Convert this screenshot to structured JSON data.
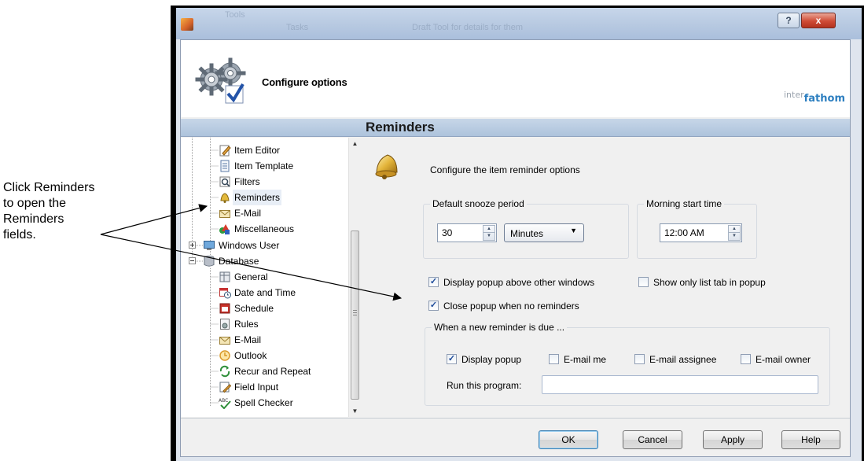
{
  "callout": {
    "lines": [
      "Click Reminders",
      "to open the",
      "Reminders",
      "fields."
    ]
  },
  "titlebar": {
    "help_label": "?",
    "close_label": "x",
    "ghost_text": [
      "Tools",
      "Tasks",
      "Draft Tool for details for them"
    ]
  },
  "header": {
    "title": "Configure options",
    "brand_prefix": "inter",
    "brand_name": "fathom"
  },
  "section_title": "Reminders",
  "tree": {
    "items": [
      {
        "label": "Item Editor",
        "icon": "pencil-icon"
      },
      {
        "label": "Item Template",
        "icon": "template-icon"
      },
      {
        "label": "Filters",
        "icon": "filter-icon"
      },
      {
        "label": "Reminders",
        "icon": "bell-icon",
        "selected": true
      },
      {
        "label": "E-Mail",
        "icon": "envelope-icon"
      },
      {
        "label": "Miscellaneous",
        "icon": "shapes-icon"
      },
      {
        "label": "Windows User",
        "icon": "computer-icon"
      },
      {
        "label": "Database",
        "icon": "database-icon"
      },
      {
        "label": "General",
        "icon": "table-icon"
      },
      {
        "label": "Date and Time",
        "icon": "calendar-clock-icon"
      },
      {
        "label": "Schedule",
        "icon": "calendar-icon"
      },
      {
        "label": "Rules",
        "icon": "rules-icon"
      },
      {
        "label": "E-Mail",
        "icon": "envelope-icon"
      },
      {
        "label": "Outlook",
        "icon": "outlook-icon"
      },
      {
        "label": "Recur and Repeat",
        "icon": "recur-icon"
      },
      {
        "label": "Field Input",
        "icon": "field-input-icon"
      },
      {
        "label": "Spell Checker",
        "icon": "spell-check-icon"
      }
    ]
  },
  "panel": {
    "intro": "Configure the item reminder options",
    "snooze": {
      "legend": "Default snooze period",
      "value": "30",
      "unit": "Minutes"
    },
    "morning": {
      "legend": "Morning start time",
      "value": "12:00 AM"
    },
    "options": {
      "display_above": {
        "label": "Display popup above other windows",
        "checked": true
      },
      "only_list_tab": {
        "label": "Show only list tab in popup",
        "checked": false
      },
      "close_popup": {
        "label": "Close popup when no reminders",
        "checked": true
      }
    },
    "due": {
      "legend": "When a new reminder is due ...",
      "display_popup": {
        "label": "Display popup",
        "checked": true
      },
      "email_me": {
        "label": "E-mail me",
        "checked": false
      },
      "email_assignee": {
        "label": "E-mail assignee",
        "checked": false
      },
      "email_owner": {
        "label": "E-mail owner",
        "checked": false
      },
      "run_program_label": "Run this program:",
      "run_program_value": ""
    }
  },
  "buttons": {
    "ok": "OK",
    "cancel": "Cancel",
    "apply": "Apply",
    "help": "Help"
  },
  "colors": {
    "section_bar": "#b8cce2",
    "brand": "#2d7fc0",
    "title_bar": "#b7c9e1"
  }
}
